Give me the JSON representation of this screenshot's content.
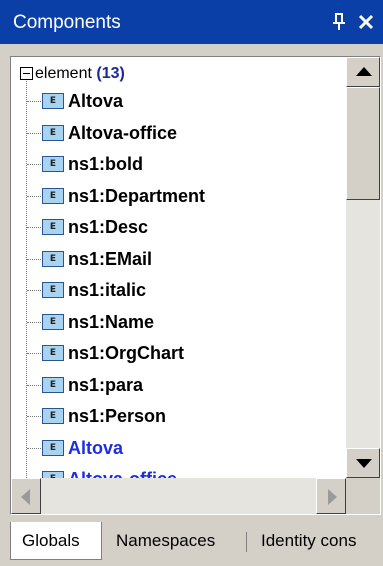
{
  "window": {
    "title": "Components",
    "pin_glyph": "ͱ",
    "close_glyph": "✕"
  },
  "tree": {
    "root": {
      "label": "element",
      "count": "(13)",
      "expanded": true
    },
    "items": [
      {
        "label": "Altova",
        "icon": "E",
        "color": "#000000"
      },
      {
        "label": "Altova-office",
        "icon": "E",
        "color": "#000000"
      },
      {
        "label": "ns1:bold",
        "icon": "E",
        "color": "#000000"
      },
      {
        "label": "ns1:Department",
        "icon": "E",
        "color": "#000000"
      },
      {
        "label": "ns1:Desc",
        "icon": "E",
        "color": "#000000"
      },
      {
        "label": "ns1:EMail",
        "icon": "E",
        "color": "#000000"
      },
      {
        "label": "ns1:italic",
        "icon": "E",
        "color": "#000000"
      },
      {
        "label": "ns1:Name",
        "icon": "E",
        "color": "#000000"
      },
      {
        "label": "ns1:OrgChart",
        "icon": "E",
        "color": "#000000"
      },
      {
        "label": "ns1:para",
        "icon": "E",
        "color": "#000000"
      },
      {
        "label": "ns1:Person",
        "icon": "E",
        "color": "#000000"
      },
      {
        "label": "Altova",
        "icon": "E",
        "color": "#1c2ee0"
      },
      {
        "label": "Altova-office",
        "icon": "E",
        "color": "#1c2ee0"
      }
    ]
  },
  "tabs": [
    {
      "label": "Globals",
      "active": true
    },
    {
      "label": "Namespaces",
      "active": false
    },
    {
      "label": "Identity cons",
      "active": false
    }
  ],
  "colors": {
    "titlebar": "#0a3fa8",
    "highlight_text": "#1c2ee0",
    "element_icon_fill": "#a9d4f1"
  },
  "icons": {
    "pin": "pin-icon",
    "close": "close-icon",
    "collapse": "collapse-minus-icon",
    "element": "element-e-icon",
    "scroll_up": "arrow-up-icon",
    "scroll_down": "arrow-down-icon",
    "scroll_left": "arrow-left-icon",
    "scroll_right": "arrow-right-icon"
  }
}
